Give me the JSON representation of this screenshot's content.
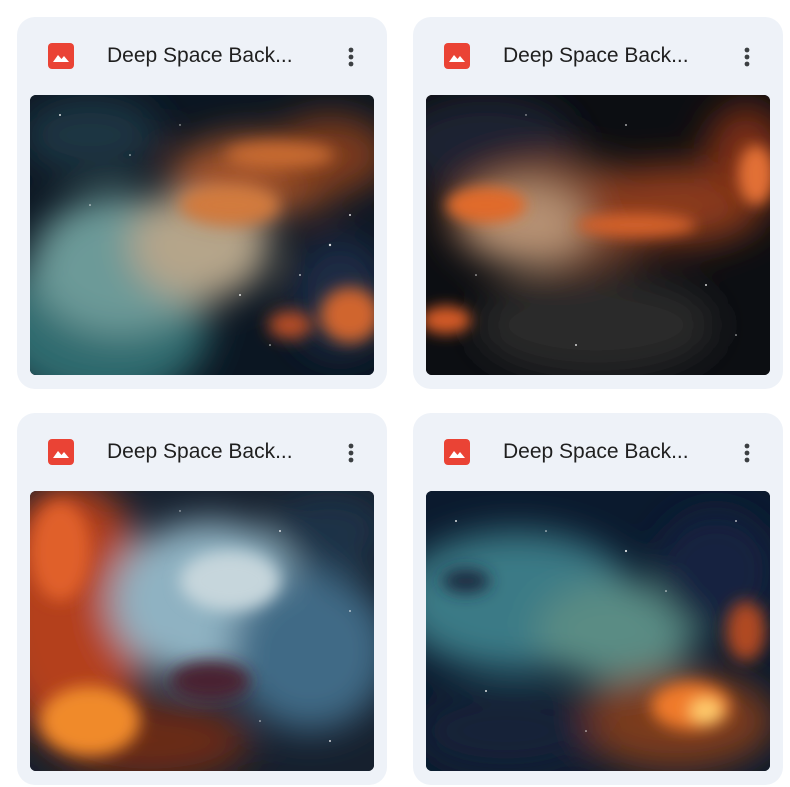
{
  "files": [
    {
      "title": "Deep Space Back...",
      "icon": "image-file-icon",
      "menu_icon": "more-vert-icon",
      "thumbnail": "nebula-thumbnail"
    },
    {
      "title": "Deep Space Back...",
      "icon": "image-file-icon",
      "menu_icon": "more-vert-icon",
      "thumbnail": "nebula-thumbnail"
    },
    {
      "title": "Deep Space Back...",
      "icon": "image-file-icon",
      "menu_icon": "more-vert-icon",
      "thumbnail": "nebula-thumbnail"
    },
    {
      "title": "Deep Space Back...",
      "icon": "image-file-icon",
      "menu_icon": "more-vert-icon",
      "thumbnail": "nebula-thumbnail"
    }
  ],
  "colors": {
    "card_background": "#eef2f8",
    "file_icon": "#ea4335",
    "title_text": "#1f1f1f"
  }
}
